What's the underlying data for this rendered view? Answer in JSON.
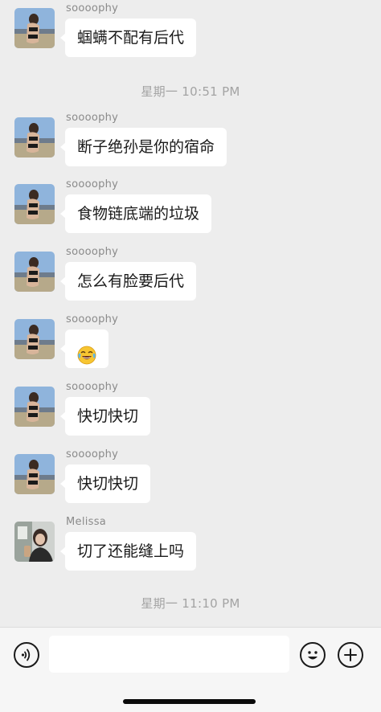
{
  "messages": [
    {
      "sender": "soooophy",
      "text": "蝈螨不配有后代",
      "avatar": "beach-photo"
    },
    {
      "sender": "soooophy",
      "text": "断子绝孙是你的宿命",
      "avatar": "beach-photo"
    },
    {
      "sender": "soooophy",
      "text": "食物链底端的垃圾",
      "avatar": "beach-photo"
    },
    {
      "sender": "soooophy",
      "text": "怎么有脸要后代",
      "avatar": "beach-photo"
    },
    {
      "sender": "soooophy",
      "text": "",
      "emoji": "tears-of-joy-emoji",
      "avatar": "beach-photo"
    },
    {
      "sender": "soooophy",
      "text": "快切快切",
      "avatar": "beach-photo"
    },
    {
      "sender": "soooophy",
      "text": "快切快切",
      "avatar": "beach-photo"
    },
    {
      "sender": "Melissa",
      "text": "切了还能缝上吗",
      "avatar": "portrait-photo"
    }
  ],
  "timestamps": [
    "星期一 10:51 PM",
    "星期一 11:10 PM"
  ],
  "input": {
    "value": "",
    "placeholder": ""
  },
  "icons": {
    "voice": "voice-icon",
    "emoji": "smiley-icon",
    "more": "plus-circle-icon"
  }
}
